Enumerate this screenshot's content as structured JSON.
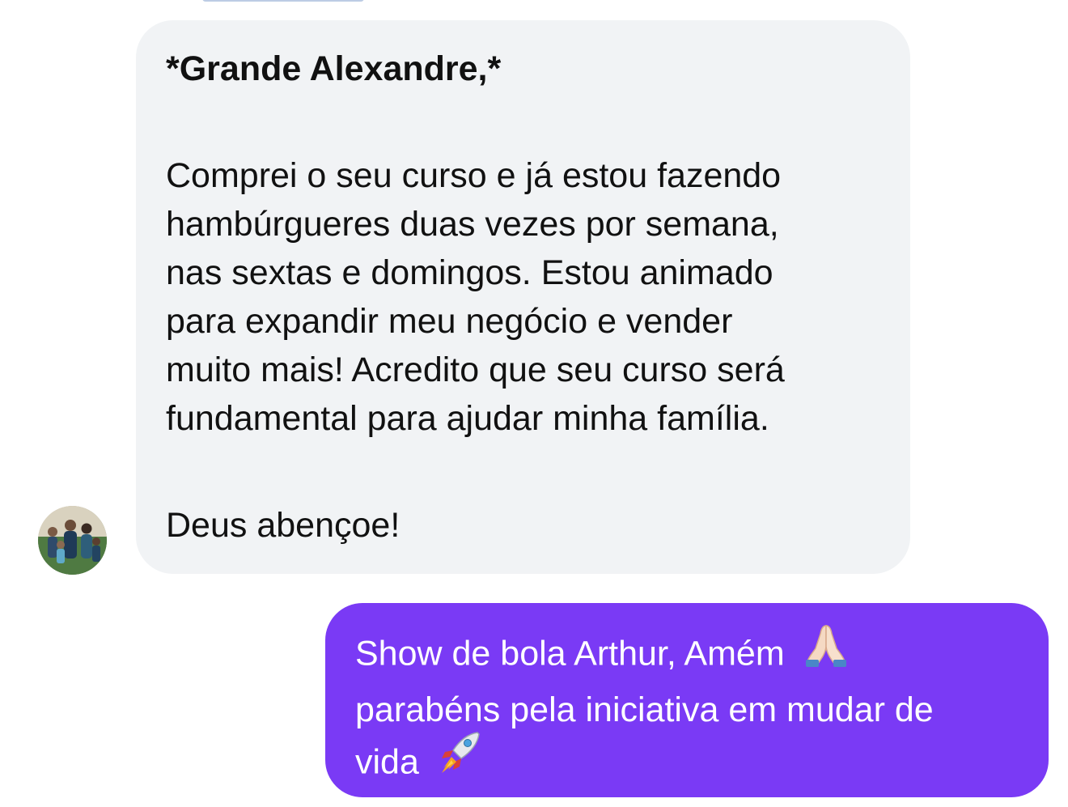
{
  "incoming_message": {
    "greeting": "*Grande Alexandre,*",
    "body_lines": [
      "Comprei o seu curso e já estou fazendo",
      "hambúrgueres duas vezes por semana,",
      "nas sextas e domingos. Estou animado",
      "para expandir meu negócio e vender",
      "muito mais! Acredito que seu curso será",
      "fundamental para ajudar minha família."
    ],
    "closing": "Deus abençoe!",
    "sender_avatar": "avatar-family-photo"
  },
  "outgoing_message": {
    "lines": [
      "Show de bola Arthur, Amém",
      "parabéns pela iniciativa em mudar de",
      "vida"
    ],
    "emojis": [
      "praying-hands-emoji",
      "rocket-emoji"
    ]
  },
  "colors": {
    "incoming_bubble": "#f1f3f5",
    "outgoing_bubble": "#7a3af5",
    "incoming_text": "#111111",
    "outgoing_text": "#ffffff"
  }
}
